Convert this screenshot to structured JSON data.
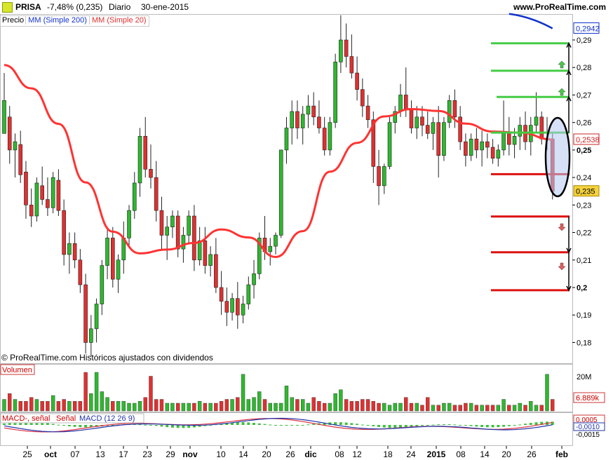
{
  "header": {
    "symbol": "PRISA",
    "change": "-7,48% (0,235)",
    "period": "Diario",
    "date": "30-ene-2015",
    "site": "www.ProRealTime.com"
  },
  "legend": {
    "price": "Precio",
    "ma200": "MM (Simple 200)",
    "ma20": "MM (Simple 20)"
  },
  "copyright": "© ProRealTime.com  Históricos ajustados con dividendos",
  "colors": {
    "up": "#2eb82e",
    "down": "#e03030",
    "ma20": "#ff3333",
    "ma200": "#1133cc",
    "green_line": "#44cc44",
    "red_line": "#dd1111",
    "macd_line": "#2233aa",
    "signal_line": "#dd3344"
  },
  "price_axis": {
    "ticks": [
      "0,29",
      "0,28",
      "0,27",
      "0,26",
      "0,25",
      "0,24",
      "0,23",
      "0,22",
      "0,21",
      "0,2",
      "0,19",
      "0,18"
    ],
    "tick_values": [
      0.29,
      0.28,
      0.27,
      0.26,
      0.25,
      0.24,
      0.23,
      0.22,
      0.21,
      0.2,
      0.19,
      0.18
    ],
    "bold_ticks": [
      "0,25",
      "0,2"
    ],
    "label_ma200": "0,2942",
    "label_ma20": "0,2538",
    "label_last": "0,235"
  },
  "volume_panel": {
    "title": "Volumen",
    "tick": "20M",
    "last_label": "6.889k"
  },
  "macd_panel": {
    "title1": "MACD-, señal",
    "title2": "Señal",
    "title3": "MACD (12 26 9)",
    "labels": [
      "0,0005",
      "-0,0010",
      "-0,0015"
    ]
  },
  "x_axis": {
    "labels": [
      "25",
      "oct",
      "07",
      "13",
      "17",
      "23",
      "29",
      "nov",
      "10",
      "14",
      "20",
      "26",
      "dic",
      "08",
      "12",
      "18",
      "24",
      "2015",
      "08",
      "14",
      "20",
      "26",
      "feb"
    ],
    "bold": [
      "oct",
      "nov",
      "dic",
      "2015",
      "feb"
    ]
  },
  "levels": {
    "resistance": [
      0.2888,
      0.2788,
      0.2693,
      0.2563
    ],
    "support": [
      0.2412,
      0.2258,
      0.2128,
      0.199
    ]
  },
  "chart_data": {
    "type": "candlestick",
    "title": "PRISA Diario 30-ene-2015",
    "ylim": [
      0.175,
      0.3
    ],
    "candles": [
      [
        0.256,
        0.278,
        0.26,
        0.268
      ],
      [
        0.262,
        0.266,
        0.245,
        0.25
      ],
      [
        0.25,
        0.256,
        0.24,
        0.253
      ],
      [
        0.252,
        0.257,
        0.238,
        0.241
      ],
      [
        0.242,
        0.246,
        0.225,
        0.23
      ],
      [
        0.23,
        0.236,
        0.222,
        0.226
      ],
      [
        0.226,
        0.24,
        0.224,
        0.238
      ],
      [
        0.237,
        0.244,
        0.23,
        0.232
      ],
      [
        0.232,
        0.24,
        0.226,
        0.229
      ],
      [
        0.229,
        0.242,
        0.227,
        0.24
      ],
      [
        0.239,
        0.243,
        0.226,
        0.228
      ],
      [
        0.228,
        0.232,
        0.208,
        0.212
      ],
      [
        0.212,
        0.22,
        0.205,
        0.216
      ],
      [
        0.216,
        0.22,
        0.207,
        0.21
      ],
      [
        0.21,
        0.214,
        0.198,
        0.201
      ],
      [
        0.201,
        0.205,
        0.176,
        0.18
      ],
      [
        0.18,
        0.19,
        0.175,
        0.185
      ],
      [
        0.185,
        0.196,
        0.18,
        0.194
      ],
      [
        0.194,
        0.21,
        0.19,
        0.208
      ],
      [
        0.208,
        0.222,
        0.203,
        0.218
      ],
      [
        0.218,
        0.222,
        0.2,
        0.203
      ],
      [
        0.203,
        0.212,
        0.198,
        0.21
      ],
      [
        0.21,
        0.224,
        0.205,
        0.218
      ],
      [
        0.218,
        0.23,
        0.215,
        0.228
      ],
      [
        0.228,
        0.242,
        0.225,
        0.238
      ],
      [
        0.238,
        0.258,
        0.233,
        0.255
      ],
      [
        0.255,
        0.262,
        0.24,
        0.243
      ],
      [
        0.243,
        0.252,
        0.236,
        0.24
      ],
      [
        0.24,
        0.246,
        0.224,
        0.228
      ],
      [
        0.228,
        0.233,
        0.214,
        0.219
      ],
      [
        0.219,
        0.226,
        0.21,
        0.222
      ],
      [
        0.222,
        0.228,
        0.218,
        0.226
      ],
      [
        0.226,
        0.228,
        0.211,
        0.214
      ],
      [
        0.214,
        0.222,
        0.209,
        0.219
      ],
      [
        0.219,
        0.228,
        0.216,
        0.226
      ],
      [
        0.226,
        0.23,
        0.206,
        0.21
      ],
      [
        0.21,
        0.222,
        0.208,
        0.217
      ],
      [
        0.217,
        0.222,
        0.205,
        0.208
      ],
      [
        0.208,
        0.215,
        0.204,
        0.212
      ],
      [
        0.212,
        0.218,
        0.198,
        0.2
      ],
      [
        0.2,
        0.206,
        0.19,
        0.195
      ],
      [
        0.195,
        0.2,
        0.186,
        0.191
      ],
      [
        0.191,
        0.198,
        0.188,
        0.196
      ],
      [
        0.196,
        0.202,
        0.185,
        0.19
      ],
      [
        0.19,
        0.197,
        0.187,
        0.194
      ],
      [
        0.194,
        0.204,
        0.192,
        0.201
      ],
      [
        0.201,
        0.21,
        0.196,
        0.205
      ],
      [
        0.205,
        0.22,
        0.203,
        0.218
      ],
      [
        0.218,
        0.226,
        0.21,
        0.213
      ],
      [
        0.213,
        0.218,
        0.208,
        0.215
      ],
      [
        0.215,
        0.22,
        0.212,
        0.219
      ],
      [
        0.219,
        0.25,
        0.218,
        0.25
      ],
      [
        0.25,
        0.262,
        0.245,
        0.258
      ],
      [
        0.258,
        0.268,
        0.252,
        0.264
      ],
      [
        0.264,
        0.268,
        0.254,
        0.258
      ],
      [
        0.258,
        0.266,
        0.252,
        0.263
      ],
      [
        0.263,
        0.27,
        0.258,
        0.266
      ],
      [
        0.266,
        0.271,
        0.259,
        0.262
      ],
      [
        0.262,
        0.268,
        0.256,
        0.258
      ],
      [
        0.258,
        0.262,
        0.248,
        0.25
      ],
      [
        0.25,
        0.262,
        0.248,
        0.26
      ],
      [
        0.26,
        0.285,
        0.258,
        0.282
      ],
      [
        0.282,
        0.299,
        0.278,
        0.29
      ],
      [
        0.29,
        0.296,
        0.28,
        0.284
      ],
      [
        0.284,
        0.292,
        0.276,
        0.278
      ],
      [
        0.278,
        0.284,
        0.268,
        0.272
      ],
      [
        0.272,
        0.276,
        0.262,
        0.266
      ],
      [
        0.266,
        0.27,
        0.258,
        0.261
      ],
      [
        0.261,
        0.264,
        0.238,
        0.244
      ],
      [
        0.244,
        0.25,
        0.23,
        0.237
      ],
      [
        0.237,
        0.245,
        0.234,
        0.244
      ],
      [
        0.244,
        0.262,
        0.243,
        0.26
      ],
      [
        0.26,
        0.266,
        0.256,
        0.264
      ],
      [
        0.264,
        0.274,
        0.262,
        0.27
      ],
      [
        0.27,
        0.28,
        0.262,
        0.265
      ],
      [
        0.265,
        0.268,
        0.256,
        0.258
      ],
      [
        0.258,
        0.266,
        0.254,
        0.262
      ],
      [
        0.262,
        0.266,
        0.255,
        0.259
      ],
      [
        0.259,
        0.264,
        0.254,
        0.256
      ],
      [
        0.256,
        0.262,
        0.25,
        0.26
      ],
      [
        0.26,
        0.266,
        0.24,
        0.248
      ],
      [
        0.248,
        0.262,
        0.246,
        0.26
      ],
      [
        0.26,
        0.27,
        0.258,
        0.268
      ],
      [
        0.268,
        0.272,
        0.258,
        0.262
      ],
      [
        0.262,
        0.266,
        0.25,
        0.253
      ],
      [
        0.253,
        0.256,
        0.244,
        0.248
      ],
      [
        0.248,
        0.256,
        0.246,
        0.254
      ],
      [
        0.254,
        0.258,
        0.247,
        0.25
      ],
      [
        0.25,
        0.257,
        0.244,
        0.253
      ],
      [
        0.253,
        0.256,
        0.247,
        0.251
      ],
      [
        0.251,
        0.254,
        0.245,
        0.247
      ],
      [
        0.247,
        0.252,
        0.244,
        0.25
      ],
      [
        0.25,
        0.268,
        0.248,
        0.256
      ],
      [
        0.256,
        0.262,
        0.248,
        0.252
      ],
      [
        0.252,
        0.258,
        0.247,
        0.255
      ],
      [
        0.255,
        0.262,
        0.25,
        0.259
      ],
      [
        0.259,
        0.264,
        0.25,
        0.253
      ],
      [
        0.253,
        0.262,
        0.248,
        0.259
      ],
      [
        0.259,
        0.271,
        0.256,
        0.262
      ],
      [
        0.262,
        0.264,
        0.252,
        0.254
      ],
      [
        0.254,
        0.262,
        0.25,
        0.254
      ],
      [
        0.254,
        0.256,
        0.232,
        0.235
      ]
    ],
    "ma20": [
      [
        0,
        0.2809
      ],
      [
        5,
        0.2724
      ],
      [
        10,
        0.2595
      ],
      [
        15,
        0.2382
      ],
      [
        20,
        0.2203
      ],
      [
        25,
        0.2124
      ],
      [
        30,
        0.2138
      ],
      [
        35,
        0.2162
      ],
      [
        40,
        0.2211
      ],
      [
        45,
        0.2182
      ],
      [
        50,
        0.2111
      ],
      [
        55,
        0.2205
      ],
      [
        60,
        0.2421
      ],
      [
        65,
        0.2526
      ],
      [
        70,
        0.2622
      ],
      [
        75,
        0.2649
      ],
      [
        80,
        0.2642
      ],
      [
        85,
        0.2596
      ],
      [
        90,
        0.2567
      ],
      [
        95,
        0.2563
      ],
      [
        101,
        0.2538
      ]
    ],
    "ma200": [
      [
        93,
        0.2995
      ],
      [
        101,
        0.2942
      ]
    ],
    "volume": [
      6,
      9,
      6,
      5,
      5,
      7,
      6,
      5,
      5,
      8,
      5,
      6,
      5,
      5,
      5,
      20,
      9,
      20,
      10,
      7,
      5,
      5,
      5,
      4,
      4,
      5,
      7,
      18,
      6,
      6,
      4,
      4,
      4,
      4,
      4,
      4,
      5,
      4,
      4,
      4,
      5,
      6,
      6,
      7,
      19,
      6,
      7,
      10,
      6,
      4,
      4,
      4,
      13,
      7,
      6,
      6,
      4,
      7,
      5,
      4,
      4,
      9,
      11,
      6,
      5,
      5,
      6,
      6,
      5,
      4,
      4,
      3,
      4,
      4,
      7,
      4,
      4,
      3,
      7,
      3,
      3,
      4,
      4,
      3,
      3,
      4,
      4,
      3,
      3,
      3,
      3,
      3,
      6,
      3,
      3,
      4,
      3,
      5,
      3,
      3,
      19,
      6
    ],
    "volume_unit": "millions"
  }
}
